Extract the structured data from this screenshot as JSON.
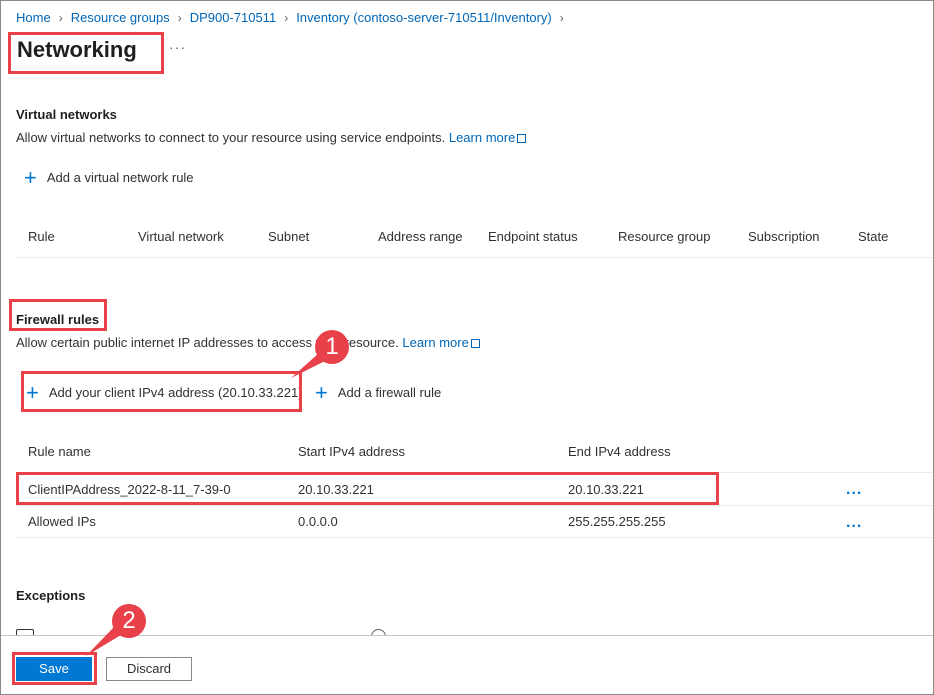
{
  "breadcrumb": [
    "Home",
    "Resource groups",
    "DP900-710511",
    "Inventory (contoso-server-710511/Inventory)"
  ],
  "page": {
    "title": "Networking",
    "more": "···"
  },
  "virtual_networks": {
    "heading": "Virtual networks",
    "description": "Allow virtual networks to connect to your resource using service endpoints.",
    "learn_more": "Learn more",
    "add_rule": "Add a virtual network rule",
    "columns": [
      "Rule",
      "Virtual network",
      "Subnet",
      "Address range",
      "Endpoint status",
      "Resource group",
      "Subscription",
      "State"
    ]
  },
  "firewall": {
    "heading": "Firewall rules",
    "description": "Allow certain public internet IP addresses to access your resource.",
    "learn_more": "Learn more",
    "add_client": "Add your client IPv4 address (20.10.33.221)",
    "add_rule": "Add a firewall rule",
    "columns": [
      "Rule name",
      "Start IPv4 address",
      "End IPv4 address"
    ],
    "rows": [
      {
        "name": "ClientIPAddress_2022-8-11_7-39-0",
        "start": "20.10.33.221",
        "end": "20.10.33.221",
        "more": "..."
      },
      {
        "name": "Allowed IPs",
        "start": "0.0.0.0",
        "end": "255.255.255.255",
        "more": "..."
      }
    ]
  },
  "exceptions": {
    "heading": "Exceptions"
  },
  "footer": {
    "save": "Save",
    "discard": "Discard"
  },
  "annotations": {
    "badge1": "1",
    "badge2": "2"
  },
  "colors": {
    "accent": "#0078d4",
    "link": "#0067b8",
    "highlight": "#e8414a"
  }
}
